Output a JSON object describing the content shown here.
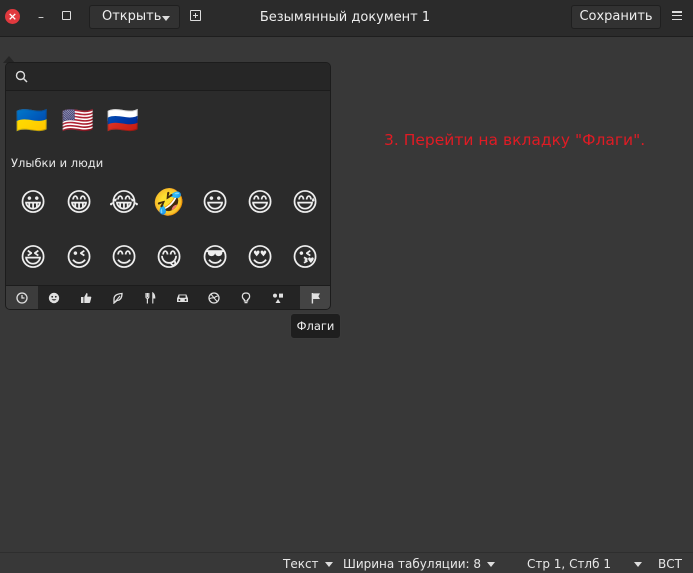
{
  "window": {
    "title": "Безымянный документ 1",
    "close_glyph": "×",
    "minimize_glyph": "–",
    "open_label": "Открыть",
    "save_label": "Сохранить"
  },
  "emoji_chooser": {
    "search_placeholder": "",
    "recent": [
      "🇺🇦",
      "🇺🇸",
      "🇷🇺"
    ],
    "section_title": "Улыбки и люди",
    "smileys_row1": [
      "😀",
      "😁",
      "😂",
      "🤣",
      "😃",
      "😄",
      "😅"
    ],
    "smileys_row2": [
      "😆",
      "😉",
      "😊",
      "😋",
      "😎",
      "😍",
      "😘"
    ],
    "categories": [
      {
        "name": "recent-icon",
        "active": true
      },
      {
        "name": "smiley-icon",
        "active": false
      },
      {
        "name": "thumbs-up-icon",
        "active": false
      },
      {
        "name": "nature-icon",
        "active": false
      },
      {
        "name": "food-icon",
        "active": false
      },
      {
        "name": "car-icon",
        "active": false
      },
      {
        "name": "activity-icon",
        "active": false
      },
      {
        "name": "lightbulb-icon",
        "active": false
      },
      {
        "name": "symbols-icon",
        "active": false
      },
      {
        "name": "flag-icon",
        "active": false
      }
    ],
    "tooltip": "Флаги"
  },
  "annotation": "3. Перейти на вкладку \"Флаги\".",
  "statusbar": {
    "syntax": "Текст",
    "tab_width": "Ширина табуляции: 8",
    "cursor": "Стр 1, Стлб 1",
    "insert_mode": "ВСТ"
  },
  "colors": {
    "annotation": "#e01b24",
    "close_button": "#e0393e",
    "background": "#383838"
  }
}
